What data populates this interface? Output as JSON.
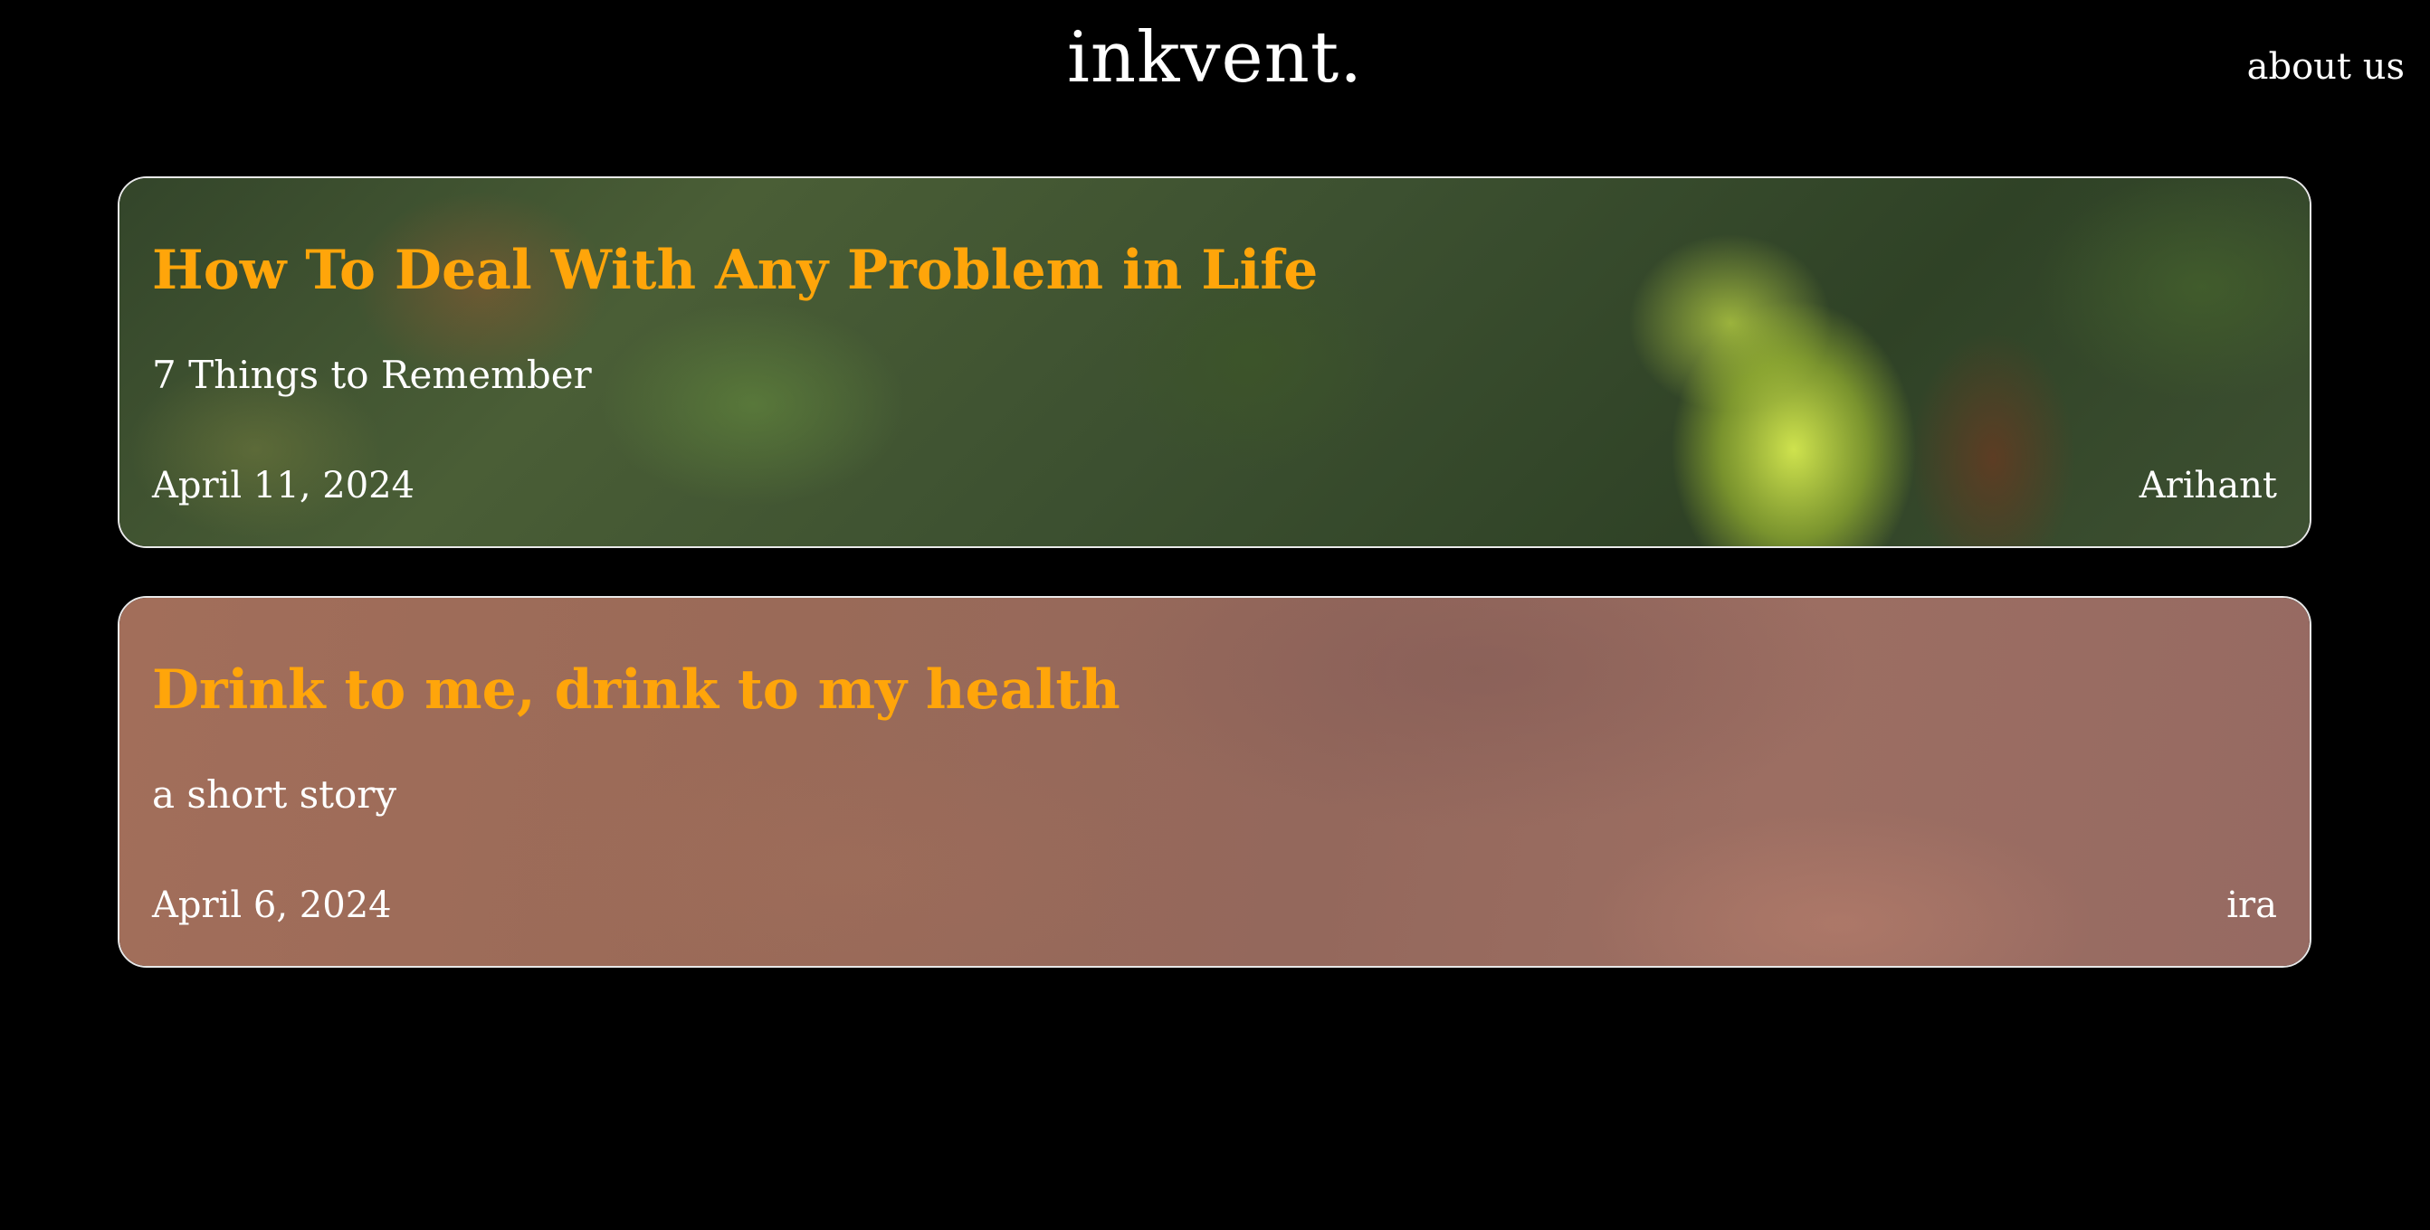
{
  "header": {
    "brand": "inkvent.",
    "nav_link": "about us"
  },
  "posts": [
    {
      "title": "How To Deal With Any Problem in Life",
      "subtitle": "7 Things to Remember",
      "date": "April 11, 2024",
      "author": "Arihant"
    },
    {
      "title": "Drink to me, drink to my health",
      "subtitle": "a short story",
      "date": "April 6, 2024",
      "author": "ira"
    }
  ],
  "colors": {
    "background": "#000000",
    "title_accent": "#ffa50a",
    "text": "#ffffff",
    "card_border": "#e9e9e9"
  }
}
